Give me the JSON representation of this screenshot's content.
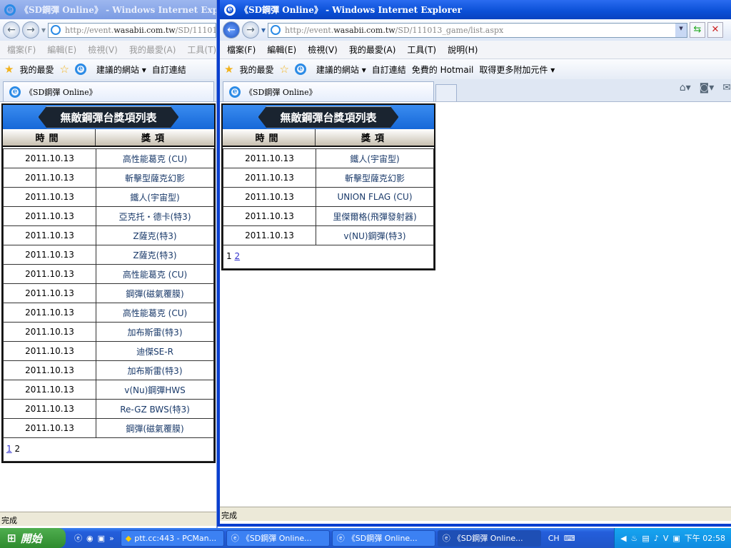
{
  "browser": {
    "window_title": "《SD鋼彈 Online》 - Windows Internet Explorer",
    "url_host_prefix": "http://event.",
    "url_host": "wasabii.com.tw",
    "url_path": "/SD/111013_game/list.aspx",
    "url_path_short": "/SD/111013_g",
    "menu": [
      "檔案(F)",
      "編輯(E)",
      "檢視(V)",
      "我的最愛(A)",
      "工具(T)",
      "說明(H)"
    ],
    "favorites_label": "我的最愛",
    "fav_links": [
      "建議的網站 ▾",
      "自訂連結",
      "免費的 Hotmail",
      "取得更多附加元件 ▾"
    ],
    "tab_title": "《SD鋼彈 Online》",
    "status": "完成"
  },
  "board": {
    "title": "無敵鋼彈台獎項列表",
    "col_time": "時間",
    "col_prize": "獎項"
  },
  "page2": {
    "rows": [
      [
        "2011.10.13",
        "高性能葛克 (CU)"
      ],
      [
        "2011.10.13",
        "斬擊型薩克幻影"
      ],
      [
        "2011.10.13",
        "鐵人(宇宙型)"
      ],
      [
        "2011.10.13",
        "亞克托・德卡(特3)"
      ],
      [
        "2011.10.13",
        "Z薩克(特3)"
      ],
      [
        "2011.10.13",
        "Z薩克(特3)"
      ],
      [
        "2011.10.13",
        "高性能葛克 (CU)"
      ],
      [
        "2011.10.13",
        "鋼彈(磁氣覆膜)"
      ],
      [
        "2011.10.13",
        "高性能葛克 (CU)"
      ],
      [
        "2011.10.13",
        "加布斯雷(特3)"
      ],
      [
        "2011.10.13",
        "迪傑SE-R"
      ],
      [
        "2011.10.13",
        "加布斯雷(特3)"
      ],
      [
        "2011.10.13",
        "v(Nu)鋼彈HWS"
      ],
      [
        "2011.10.13",
        "Re-GZ BWS(特3)"
      ],
      [
        "2011.10.13",
        "鋼彈(磁氣覆膜)"
      ]
    ],
    "pages": [
      "1",
      "2"
    ]
  },
  "page1": {
    "rows": [
      [
        "2011.10.13",
        "鐵人(宇宙型)"
      ],
      [
        "2011.10.13",
        "斬擊型薩克幻影"
      ],
      [
        "2011.10.13",
        "UNION FLAG (CU)"
      ],
      [
        "2011.10.13",
        "里傑爾格(飛彈發射器)"
      ],
      [
        "2011.10.13",
        "v(NU)鋼彈(特3)"
      ]
    ],
    "pages": [
      "1",
      "2"
    ]
  },
  "taskbar": {
    "start": "開始",
    "items": [
      "ptt.cc:443 - PCMan...",
      "《SD鋼彈 Online...",
      "《SD鋼彈 Online...",
      "《SD鋼彈 Online..."
    ],
    "lang": "CH",
    "clock": "下午 02:58"
  }
}
